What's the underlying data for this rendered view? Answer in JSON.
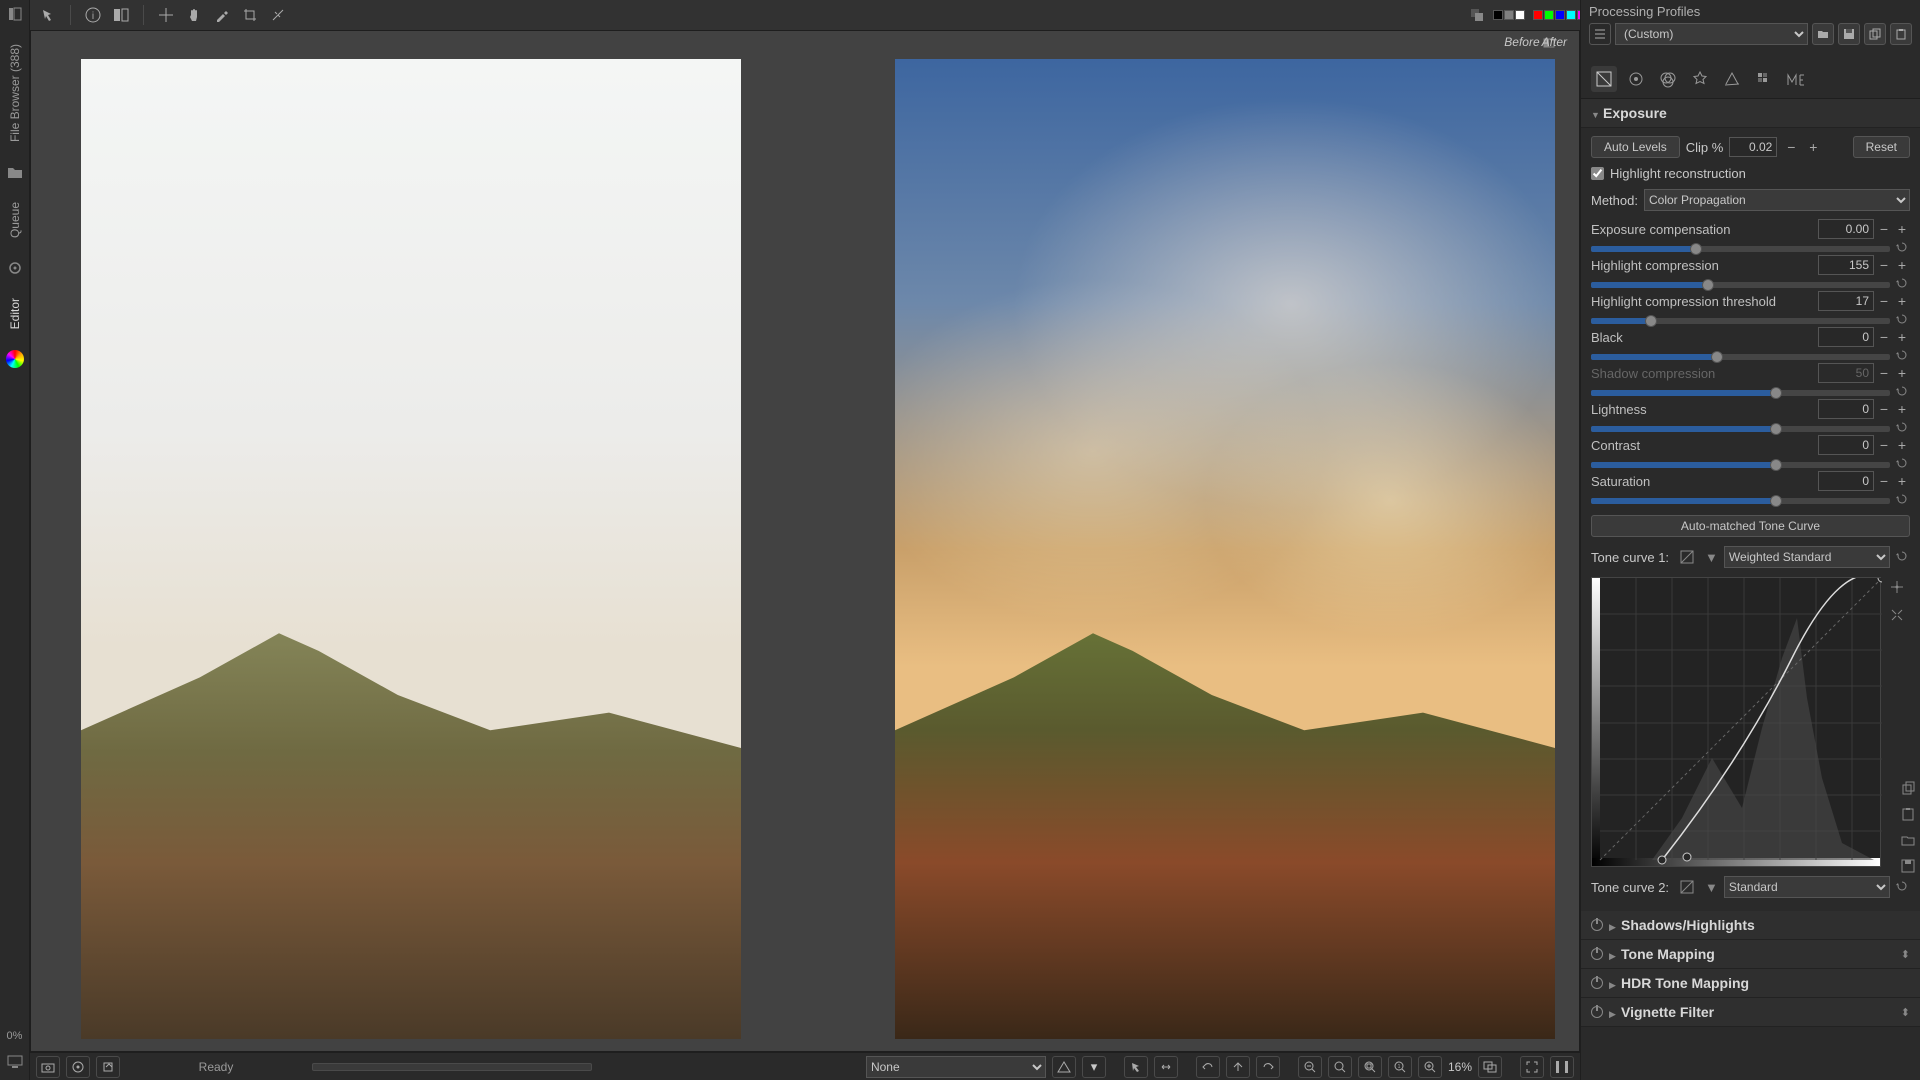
{
  "leftRail": {
    "tabs": [
      "File Browser (388)",
      "Queue",
      "Editor"
    ],
    "progress": "0%"
  },
  "toolbar": {
    "colorSwatches": [
      "#000000",
      "#808080",
      "#ffffff",
      "",
      "#ff0000",
      "#00ff00",
      "#0000ff",
      "#00ffff",
      "#ff00ff",
      "#ffff00"
    ]
  },
  "profiles": {
    "title": "Processing Profiles",
    "selected": "(Custom)"
  },
  "viewer": {
    "beforeLabel": "Before",
    "afterLabel": "After"
  },
  "status": {
    "ready": "Ready",
    "colorMgmt": "None",
    "zoom": "16%"
  },
  "rightTabs": [
    "exposure",
    "detail",
    "color",
    "advanced",
    "transform",
    "raw",
    "meta"
  ],
  "exposure": {
    "title": "Exposure",
    "autoLevels": "Auto Levels",
    "clipLabel": "Clip %",
    "clipValue": "0.02",
    "reset": "Reset",
    "hlReconLabel": "Highlight reconstruction",
    "hlReconChecked": true,
    "methodLabel": "Method:",
    "methodValue": "Color Propagation",
    "params": [
      {
        "key": "expcomp",
        "label": "Exposure compensation",
        "value": "0.00",
        "pos": 35,
        "fill": 35,
        "disabled": false
      },
      {
        "key": "hlcomp",
        "label": "Highlight compression",
        "value": "155",
        "pos": 39,
        "fill": 39,
        "disabled": false
      },
      {
        "key": "hlthr",
        "label": "Highlight compression threshold",
        "value": "17",
        "pos": 20,
        "fill": 20,
        "disabled": false
      },
      {
        "key": "black",
        "label": "Black",
        "value": "0",
        "pos": 42,
        "fill": 42,
        "disabled": false
      },
      {
        "key": "shcomp",
        "label": "Shadow compression",
        "value": "50",
        "pos": 62,
        "fill": 62,
        "disabled": true
      },
      {
        "key": "light",
        "label": "Lightness",
        "value": "0",
        "pos": 62,
        "fill": 62,
        "disabled": false
      },
      {
        "key": "contrast",
        "label": "Contrast",
        "value": "0",
        "pos": 62,
        "fill": 62,
        "disabled": false
      },
      {
        "key": "sat",
        "label": "Saturation",
        "value": "0",
        "pos": 62,
        "fill": 62,
        "disabled": false
      }
    ],
    "autoMatched": "Auto-matched Tone Curve",
    "tc1Label": "Tone curve 1:",
    "tc1Type": "Weighted Standard",
    "tc2Label": "Tone curve 2:",
    "tc2Type": "Standard"
  },
  "collapsedTools": [
    {
      "name": "Shadows/Highlights",
      "bold": true,
      "hist": false
    },
    {
      "name": "Tone Mapping",
      "bold": true,
      "hist": true
    },
    {
      "name": "HDR Tone Mapping",
      "bold": true,
      "hist": false
    },
    {
      "name": "Vignette Filter",
      "bold": true,
      "hist": true
    }
  ]
}
